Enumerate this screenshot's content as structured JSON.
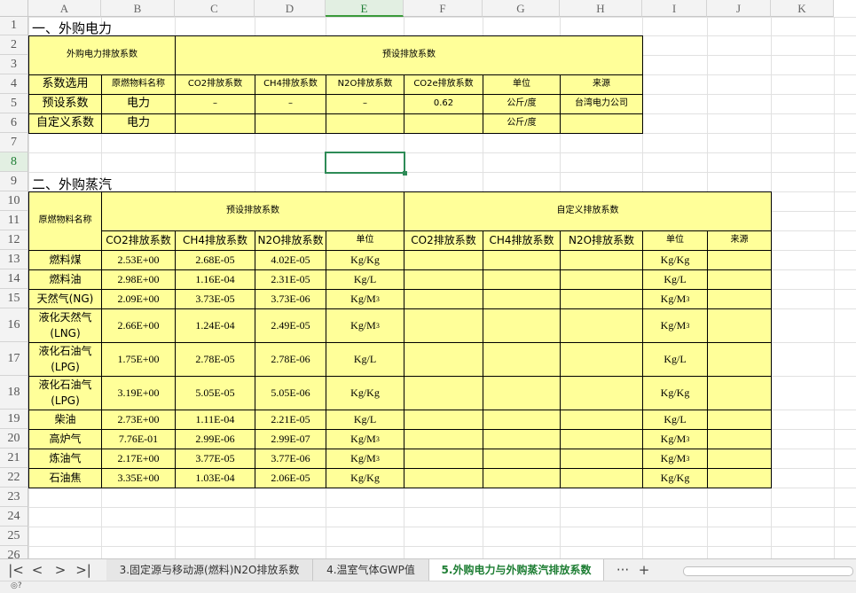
{
  "columns": [
    "A",
    "B",
    "C",
    "D",
    "E",
    "F",
    "G",
    "H",
    "I",
    "J",
    "K"
  ],
  "selected_column": "E",
  "rows": [
    "1",
    "2",
    "3",
    "4",
    "5",
    "6",
    "7",
    "8",
    "9",
    "10",
    "11",
    "12",
    "13",
    "14",
    "15",
    "16",
    "17",
    "18",
    "19",
    "20",
    "21",
    "22",
    "23",
    "24",
    "25",
    "26"
  ],
  "selected_row": "8",
  "section1": {
    "title": "一、外购电力",
    "header_left": "外购电力排放系数",
    "header_right": "预设排放系数",
    "col_labels": [
      "系数选用",
      "原燃物料名称",
      "CO2排放系数",
      "CH4排放系数",
      "N2O排放系数",
      "CO2e排放系数",
      "单位",
      "来源"
    ],
    "row_preset": [
      "预设系数",
      "电力",
      "–",
      "–",
      "–",
      "0.62",
      "公斤/度",
      "台湾电力公司"
    ],
    "row_custom": [
      "自定义系数",
      "电力",
      "",
      "",
      "",
      "",
      "公斤/度",
      ""
    ]
  },
  "section2": {
    "title": "二、外购蒸汽",
    "header_material": "原燃物料名称",
    "header_preset": "预设排放系数",
    "header_custom": "自定义排放系数",
    "col_labels": [
      "CO2排放系数",
      "CH4排放系数",
      "N2O排放系数",
      "单位",
      "CO2排放系数",
      "CH4排放系数",
      "N2O排放系数",
      "单位",
      "来源"
    ],
    "rows": [
      {
        "name": "燃料煤",
        "co2": "2.53E+00",
        "ch4": "2.68E-05",
        "n2o": "4.02E-05",
        "unit": "Kg/Kg",
        "sup": "",
        "custom_unit": "Kg/Kg"
      },
      {
        "name": "燃料油",
        "co2": "2.98E+00",
        "ch4": "1.16E-04",
        "n2o": "2.31E-05",
        "unit": "Kg/L",
        "sup": "",
        "custom_unit": "Kg/L"
      },
      {
        "name": "天然气(NG)",
        "co2": "2.09E+00",
        "ch4": "3.73E-05",
        "n2o": "3.73E-06",
        "unit": "Kg/M",
        "sup": "3",
        "custom_unit": "Kg/M"
      },
      {
        "name": "液化天然气(LNG)",
        "co2": "2.66E+00",
        "ch4": "1.24E-04",
        "n2o": "2.49E-05",
        "unit": "Kg/M",
        "sup": "3",
        "custom_unit": "Kg/M"
      },
      {
        "name": "液化石油气(LPG)",
        "co2": "1.75E+00",
        "ch4": "2.78E-05",
        "n2o": "2.78E-06",
        "unit": "Kg/L",
        "sup": "",
        "custom_unit": "Kg/L"
      },
      {
        "name": "液化石油气(LPG)",
        "co2": "3.19E+00",
        "ch4": "5.05E-05",
        "n2o": "5.05E-06",
        "unit": "Kg/Kg",
        "sup": "",
        "custom_unit": "Kg/Kg"
      },
      {
        "name": "柴油",
        "co2": "2.73E+00",
        "ch4": "1.11E-04",
        "n2o": "2.21E-05",
        "unit": "Kg/L",
        "sup": "",
        "custom_unit": "Kg/L"
      },
      {
        "name": "高炉气",
        "co2": "7.76E-01",
        "ch4": "2.99E-06",
        "n2o": "2.99E-07",
        "unit": "Kg/M",
        "sup": "3",
        "custom_unit": "Kg/M"
      },
      {
        "name": "炼油气",
        "co2": "2.17E+00",
        "ch4": "3.77E-05",
        "n2o": "3.77E-06",
        "unit": "Kg/M",
        "sup": "3",
        "custom_unit": "Kg/M"
      },
      {
        "name": "石油焦",
        "co2": "3.35E+00",
        "ch4": "1.03E-04",
        "n2o": "2.06E-05",
        "unit": "Kg/Kg",
        "sup": "",
        "custom_unit": "Kg/Kg"
      }
    ]
  },
  "tabs": [
    {
      "label": "3.固定源与移动源(燃料)N2O排放系数",
      "active": false
    },
    {
      "label": "4.温室气体GWP值",
      "active": false
    },
    {
      "label": "5.外购电力与外购蒸汽排放系数",
      "active": true
    }
  ],
  "tab_nav": {
    "first": "|<",
    "prev": "<",
    "next": ">",
    "last": ">|",
    "more": "···",
    "add": "+"
  },
  "status_text": "◎?"
}
